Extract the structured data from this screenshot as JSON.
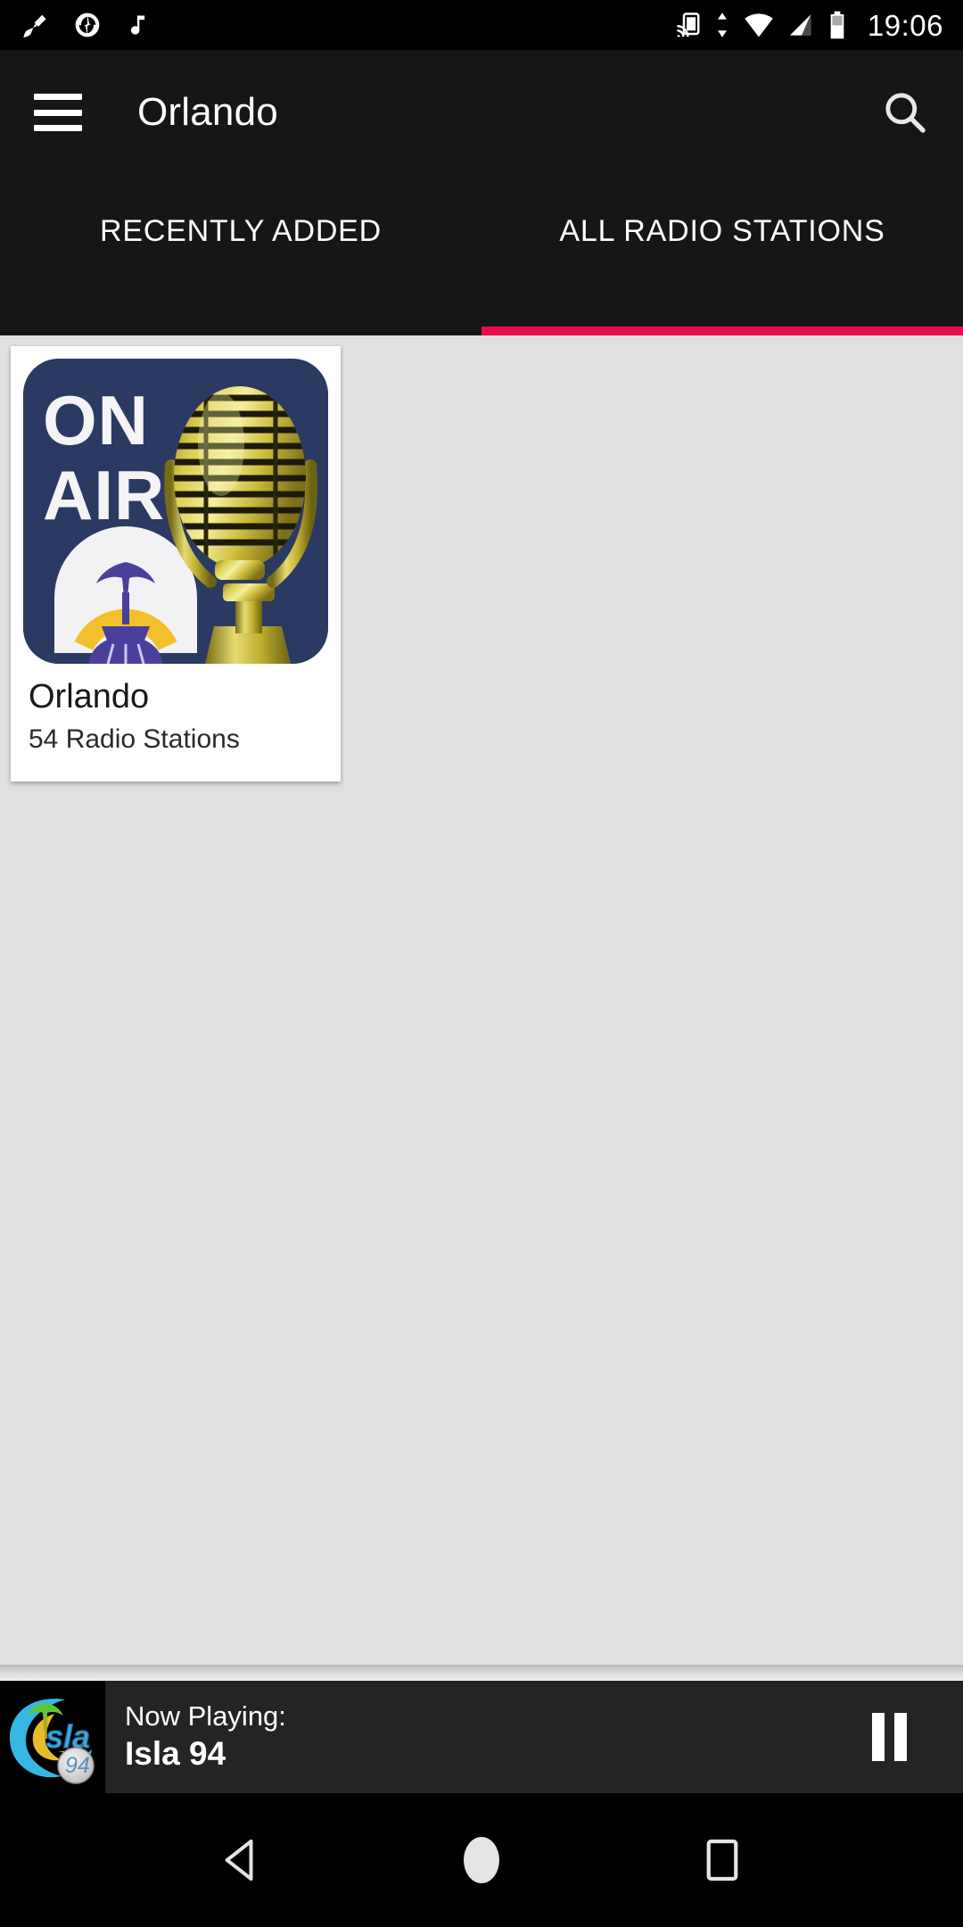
{
  "status_bar": {
    "icons_left": [
      "broom-cleaner-icon",
      "camera-aperture-icon",
      "music-note-icon"
    ],
    "icons_right": [
      "cast-screen-icon",
      "data-transfer-icon",
      "wifi-icon",
      "cellular-signal-icon",
      "battery-icon"
    ],
    "clock": "19:06"
  },
  "app_bar": {
    "menu_icon": "hamburger-menu-icon",
    "title": "Orlando",
    "search_icon": "search-icon"
  },
  "tabs": {
    "items": [
      {
        "label": "RECENTLY ADDED",
        "active": false
      },
      {
        "label": "ALL RADIO STATIONS",
        "active": true
      }
    ],
    "indicator_color": "#ec0a4f"
  },
  "content": {
    "cards": [
      {
        "title": "Orlando",
        "subtitle": "54 Radio Stations",
        "thumbnail": {
          "name": "on-air-microphone-thumbnail",
          "line1": "ON",
          "line2": "AIR",
          "bg_color": "#2b3a63",
          "mic_color": "#d4c22e",
          "seal_colors": [
            "#4b3f9e",
            "#f2c02a"
          ]
        }
      }
    ],
    "background_color": "#e0e0e0"
  },
  "now_playing": {
    "label": "Now Playing:",
    "station": "Isla 94",
    "logo_name": "isla-94-logo",
    "logo_text": "sla",
    "logo_number": "94",
    "button_icon": "pause-icon",
    "bar_color": "#242424"
  },
  "nav_bar": {
    "back_icon": "back-triangle-icon",
    "home_icon": "home-circle-icon",
    "recents_icon": "recents-square-icon"
  }
}
